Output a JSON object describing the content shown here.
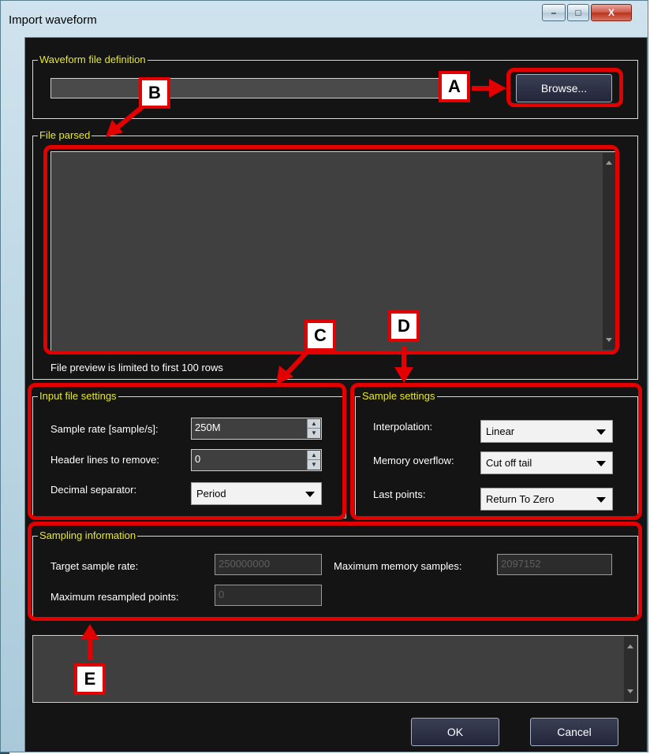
{
  "window": {
    "title": "Import waveform",
    "controls": {
      "minimize": "–",
      "maximize": "□",
      "close": "X"
    }
  },
  "waveform_file_definition": {
    "legend": "Waveform file definition",
    "file_path_value": "",
    "browse_label": "Browse..."
  },
  "file_parsed": {
    "legend": "File parsed",
    "preview_note": "File preview is limited to first 100 rows"
  },
  "input_file_settings": {
    "legend": "Input file settings",
    "sample_rate_label": "Sample rate [sample/s]:",
    "sample_rate_value": "250M",
    "header_lines_label": "Header lines to remove:",
    "header_lines_value": "0",
    "decimal_separator_label": "Decimal separator:",
    "decimal_separator_value": "Period"
  },
  "sample_settings": {
    "legend": "Sample settings",
    "interpolation_label": "Interpolation:",
    "interpolation_value": "Linear",
    "memory_overflow_label": "Memory overflow:",
    "memory_overflow_value": "Cut off tail",
    "last_points_label": "Last points:",
    "last_points_value": "Return To Zero"
  },
  "sampling_information": {
    "legend": "Sampling information",
    "target_sample_rate_label": "Target sample rate:",
    "target_sample_rate_value": "250000000",
    "max_memory_samples_label": "Maximum memory samples:",
    "max_memory_samples_value": "2097152",
    "max_resampled_points_label": "Maximum resampled points:",
    "max_resampled_points_value": "0"
  },
  "footer": {
    "ok_label": "OK",
    "cancel_label": "Cancel"
  },
  "callouts": {
    "a": "A",
    "b": "B",
    "c": "C",
    "d": "D",
    "e": "E"
  },
  "colors": {
    "client_background": "#141414",
    "legend_text": "#e8e826",
    "highlight_red": "#e20000"
  },
  "icons": {
    "spin": "spin-updown-icon",
    "dropdown": "chevron-down-icon",
    "scroll_up": "scroll-up-icon",
    "scroll_down": "scroll-down-icon"
  }
}
